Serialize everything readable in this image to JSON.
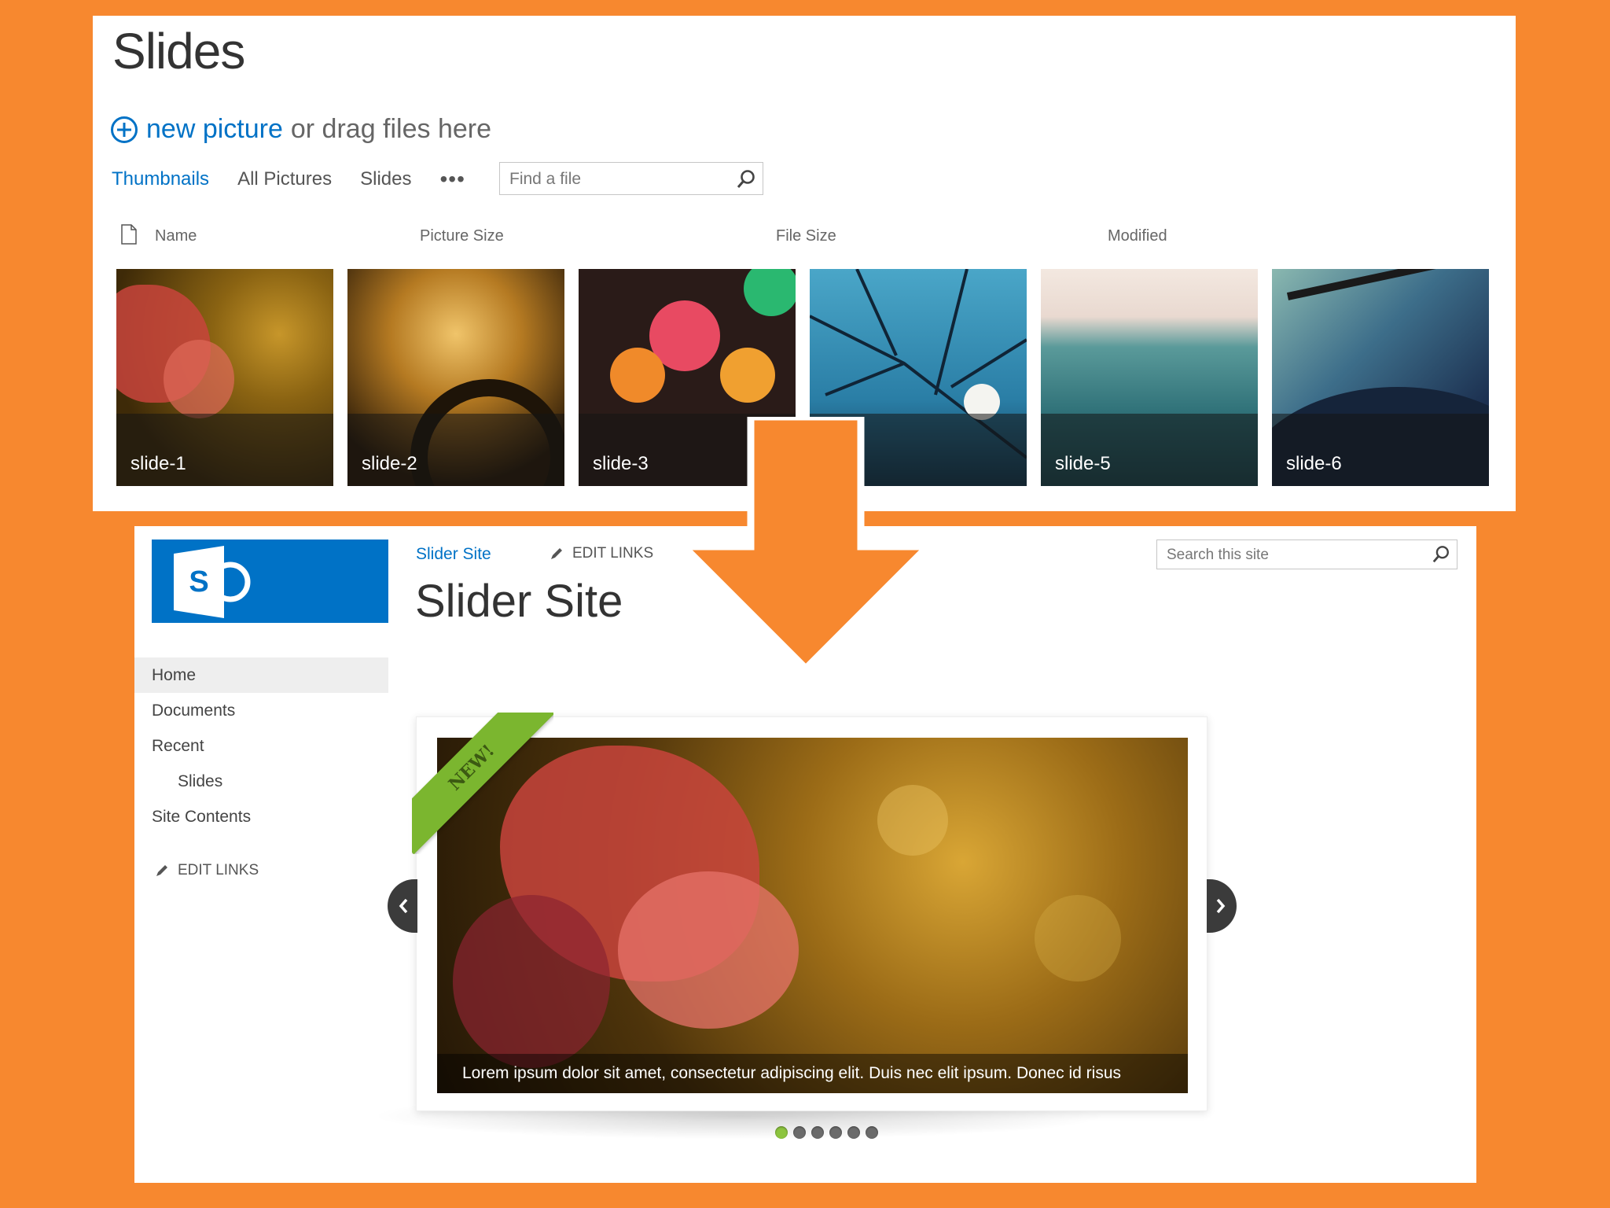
{
  "library": {
    "title": "Slides",
    "new_picture": "new picture",
    "drag_text": "or drag files here",
    "views": [
      "Thumbnails",
      "All Pictures",
      "Slides"
    ],
    "more": "•••",
    "find_placeholder": "Find a file",
    "columns": {
      "name": "Name",
      "picture_size": "Picture Size",
      "file_size": "File Size",
      "modified": "Modified"
    },
    "thumbnails": [
      {
        "label": "slide-1"
      },
      {
        "label": "slide-2"
      },
      {
        "label": "slide-3"
      },
      {
        "label": "-4"
      },
      {
        "label": "slide-5"
      },
      {
        "label": "slide-6"
      }
    ]
  },
  "site": {
    "breadcrumb": "Slider Site",
    "edit_links": "EDIT LINKS",
    "title": "Slider Site",
    "search_placeholder": "Search this site",
    "nav": [
      "Home",
      "Documents",
      "Recent",
      "Slides",
      "Site Contents"
    ],
    "nav_edit_links": "EDIT LINKS",
    "slider": {
      "ribbon": "NEW!",
      "caption": "Lorem ipsum dolor sit amet, consectetur adipiscing elit. Duis nec elit ipsum. Donec id risus",
      "dot_count": 6,
      "active_dot": 1
    }
  },
  "colors": {
    "background": "#f7882f",
    "accent": "#0072c6",
    "ribbon": "#7bb62f",
    "active_dot": "#8cc43e"
  }
}
